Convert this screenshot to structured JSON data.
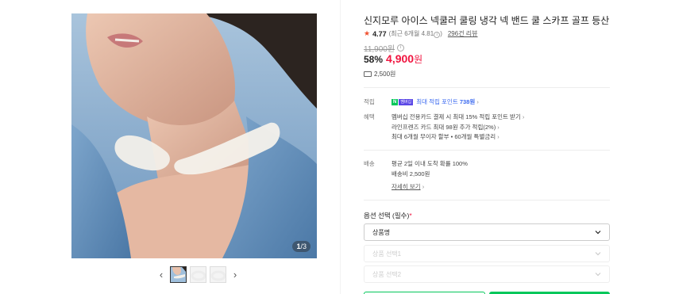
{
  "gallery": {
    "counter_current": "1",
    "counter_total": "/3",
    "prev_icon": "chevron-left-icon",
    "next_icon": "chevron-right-icon"
  },
  "product": {
    "title": "신지모루 아이스 넥쿨러 쿨링 냉각 넥 밴드 쿨 스카프 골프 등산",
    "rating": "4.77",
    "recent_rating": "(최근 6개월 4.81",
    "recent_rating_close": ")",
    "review_count": "296건 리뷰",
    "original_price": "11,900원",
    "discount": "58%",
    "price": "4,900",
    "price_unit": "원",
    "shipping": "2,500원"
  },
  "benefits": {
    "points_label": "적립",
    "npay_badge": "N",
    "membership_badge": "멤버십",
    "points_text": "최대 적립 포인트",
    "points_value": "738원",
    "discount_label": "혜택",
    "benefit_lines": [
      "멤버십 전용카드 결제 시 최대 15% 적립 포인트 받기",
      "라인프렌즈 카드 최대 98원 추가 적립(2%)",
      "최대 6개월 무이자 할부 • 60개월 특별금리"
    ]
  },
  "delivery": {
    "label": "배송",
    "arrival": "평균 2일 이내 도착 확률 100%",
    "fee": "배송비 2,500원",
    "details_link": "자세히 보기"
  },
  "options": {
    "title": "옵션 선택 (필수)",
    "required_mark": "*",
    "select_1": "상품명",
    "select_2": "상품 선택1",
    "select_3": "상품 선택2"
  },
  "colors": {
    "accent_green": "#03c75a",
    "sale_red": "#f0143f",
    "star": "#f0502f"
  }
}
